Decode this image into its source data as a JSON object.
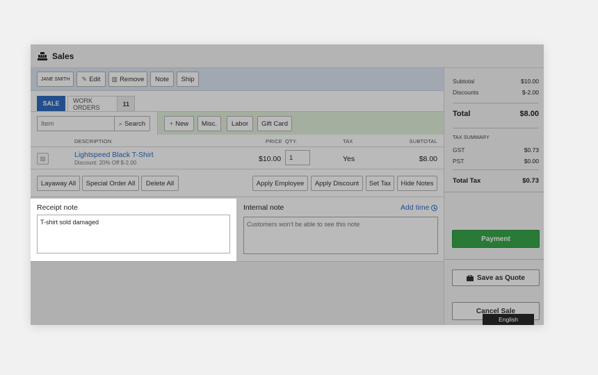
{
  "app": {
    "title": "Sales",
    "icon": "cash-register-icon"
  },
  "customer_bar": {
    "customer": "JANE SMITH",
    "edit": "Edit",
    "remove": "Remove",
    "note": "Note",
    "ship": "Ship"
  },
  "tabs": {
    "sale": "SALE",
    "work_orders": "WORK ORDERS",
    "work_orders_count": "11"
  },
  "search": {
    "placeholder": "Item",
    "search_label": "Search",
    "new": "New",
    "misc": "Misc.",
    "labor": "Labor",
    "gift_card": "Gift Card"
  },
  "table": {
    "headers": {
      "description": "DESCRIPTION",
      "price": "PRICE",
      "qty": "QTY.",
      "tax": "TAX",
      "subtotal": "SUBTOTAL"
    },
    "rows": [
      {
        "name": "Lightspeed Black T-Shirt",
        "discount": "Discount: 20% Off $-2.00",
        "price": "$10.00",
        "qty": "1",
        "tax": "Yes",
        "subtotal": "$8.00"
      }
    ]
  },
  "actions": {
    "layaway_all": "Layaway All",
    "special_order_all": "Special Order All",
    "delete_all": "Delete All",
    "apply_employee": "Apply Employee",
    "apply_discount": "Apply Discount",
    "set_tax": "Set Tax",
    "hide_notes": "Hide Notes"
  },
  "notes": {
    "receipt_label": "Receipt note",
    "receipt_value": "T-shirt sold damaged",
    "internal_label": "Internal note",
    "internal_placeholder": "Customers won't be able to see this note",
    "add_time": "Add time"
  },
  "summary": {
    "subtotal_label": "Subtotal",
    "subtotal": "$10.00",
    "discounts_label": "Discounts",
    "discounts": "$-2.00",
    "total_label": "Total",
    "total": "$8.00",
    "tax_summary_label": "TAX SUMMARY",
    "gst_label": "GST",
    "gst": "$0.73",
    "pst_label": "PST",
    "pst": "$0.00",
    "total_tax_label": "Total Tax",
    "total_tax": "$0.73",
    "payment": "Payment",
    "save_quote": "Save as Quote",
    "cancel_sale": "Cancel Sale"
  },
  "language": "English",
  "colors": {
    "accent": "#2f6dbf",
    "payment": "#38a84b",
    "customer_bar": "#dfe7f3",
    "add_bar": "#e3f0dc"
  }
}
